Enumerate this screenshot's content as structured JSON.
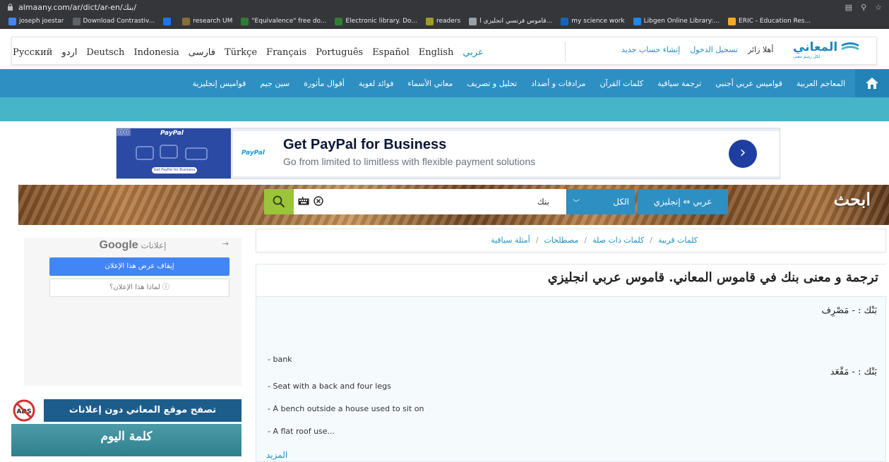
{
  "browser": {
    "url": "almaany.com/ar/dict/ar-en/بنك/",
    "bookmarks": [
      {
        "label": "joseph joestar",
        "icon": "google-icon",
        "color": "#4285f4"
      },
      {
        "label": "Download Contrastiv...",
        "icon": "document-icon",
        "color": "#5f6368"
      },
      {
        "label": "",
        "icon": "facebook-icon",
        "color": "#1877f2"
      },
      {
        "label": "research UM",
        "icon": "university-icon",
        "color": "#8a6d3b"
      },
      {
        "label": "\"Equivalence\" free do...",
        "icon": "library-icon",
        "color": "#2e7d32"
      },
      {
        "label": "Electronic library. Do...",
        "icon": "library-icon",
        "color": "#2e7d32"
      },
      {
        "label": "readers",
        "icon": "readers-icon",
        "color": "#9e9d24"
      },
      {
        "label": "قاموس فرنسي انجليزي ا...",
        "icon": "globe-icon",
        "color": "#9aa0a6"
      },
      {
        "label": "my science work",
        "icon": "msw-icon",
        "color": "#1565c0"
      },
      {
        "label": "Libgen Online Library:...",
        "icon": "libgen-icon",
        "color": "#1e88e5"
      },
      {
        "label": "ERIC - Education Res...",
        "icon": "eric-icon",
        "color": "#f9a825"
      }
    ]
  },
  "header": {
    "languages": [
      "Русский",
      "اردو",
      "Deutsch",
      "Indonesia",
      "فارسی",
      "Türkçe",
      "Français",
      "Português",
      "Español",
      "English",
      "عربي"
    ],
    "active_language": "عربي",
    "user": {
      "greeting": "أهلا زائر",
      "login": "تسجيل الدخول",
      "signup": "إنشاء حساب جديد"
    },
    "logo": {
      "title": "المعاني",
      "subtitle": "لكل رسم معنى"
    }
  },
  "nav": {
    "items": [
      "المعاجم العربية",
      "قواميس عربي أجنبي",
      "ترجمة سياقية",
      "كلمات القرآن",
      "مرادفات و أضداد",
      "تحليل و تصريف",
      "معاني الأسماء",
      "فوائد لغوية",
      "أقوال مأثورة",
      "سين جيم",
      "قواميس إنجليزية"
    ]
  },
  "ad": {
    "small_brand": "PayPal",
    "small_button": "Get PayPal for Business",
    "brand": "PayPal",
    "title": "Get PayPal for Business",
    "subtitle": "Go from limited to limitless with flexible payment solutions",
    "colors": {
      "dark_blue": "#2b4aa3",
      "arrow": "#1f3ea1"
    }
  },
  "search": {
    "title": "ابحث",
    "query": "بنك",
    "scope": "الكل",
    "dictionary": "عربي ⇔ إنجليزي",
    "accent": "#9bc43a"
  },
  "sidebar": {
    "google_ads_label": "إعلانات",
    "google_brand": "Google",
    "stop_ad": "إيقاف عرض هذا الإعلان",
    "why_ad": "لماذا هذا الإعلان؟ ⓘ",
    "noads_text": "تصفح موقع المعاني دون إعلانات",
    "noads_badge": "ADS",
    "word_of_day": "كلمة اليوم"
  },
  "breadcrumb": {
    "items": [
      "أمثلة سياقية",
      "مصطلحات",
      "كلمات ذات صلة",
      "كلمات قريبة"
    ],
    "separator": "/"
  },
  "result": {
    "title": "ترجمة و معنى بنك في قاموس المعاني. قاموس عربي انجليزي",
    "entries": [
      {
        "head": "بَنْك : - مَصْرِف",
        "glosses": [
          "- bank"
        ]
      },
      {
        "head": "بَنْك : - مَقْعَد",
        "glosses": [
          "- Seat with a back and four legs",
          "- A bench outside a house used to sit on",
          "- A flat roof use..."
        ]
      }
    ],
    "more": "المزيد"
  }
}
